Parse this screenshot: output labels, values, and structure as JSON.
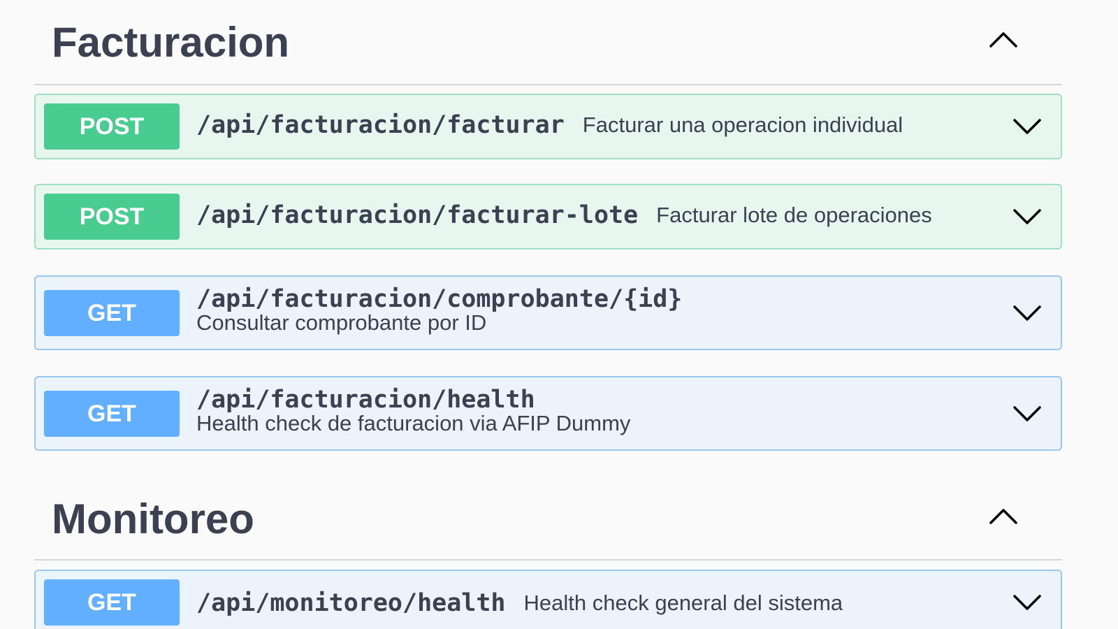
{
  "sections": [
    {
      "title": "Facturacion",
      "operations": [
        {
          "method": "POST",
          "path": "/api/facturacion/facturar",
          "summary": "Facturar una operacion individual"
        },
        {
          "method": "POST",
          "path": "/api/facturacion/facturar-lote",
          "summary": "Facturar lote de operaciones"
        },
        {
          "method": "GET",
          "path": "/api/facturacion/comprobante/{id}",
          "summary": "Consultar comprobante por ID"
        },
        {
          "method": "GET",
          "path": "/api/facturacion/health",
          "summary": "Health check de facturacion via AFIP Dummy"
        }
      ]
    },
    {
      "title": "Monitoreo",
      "operations": [
        {
          "method": "GET",
          "path": "/api/monitoreo/health",
          "summary": "Health check general del sistema"
        }
      ]
    }
  ],
  "icons": {
    "section_toggle": "chevron-up-icon",
    "operation_toggle": "chevron-down-icon"
  },
  "colors": {
    "post": "#49cc90",
    "get": "#61affe",
    "text": "#3b4151"
  }
}
